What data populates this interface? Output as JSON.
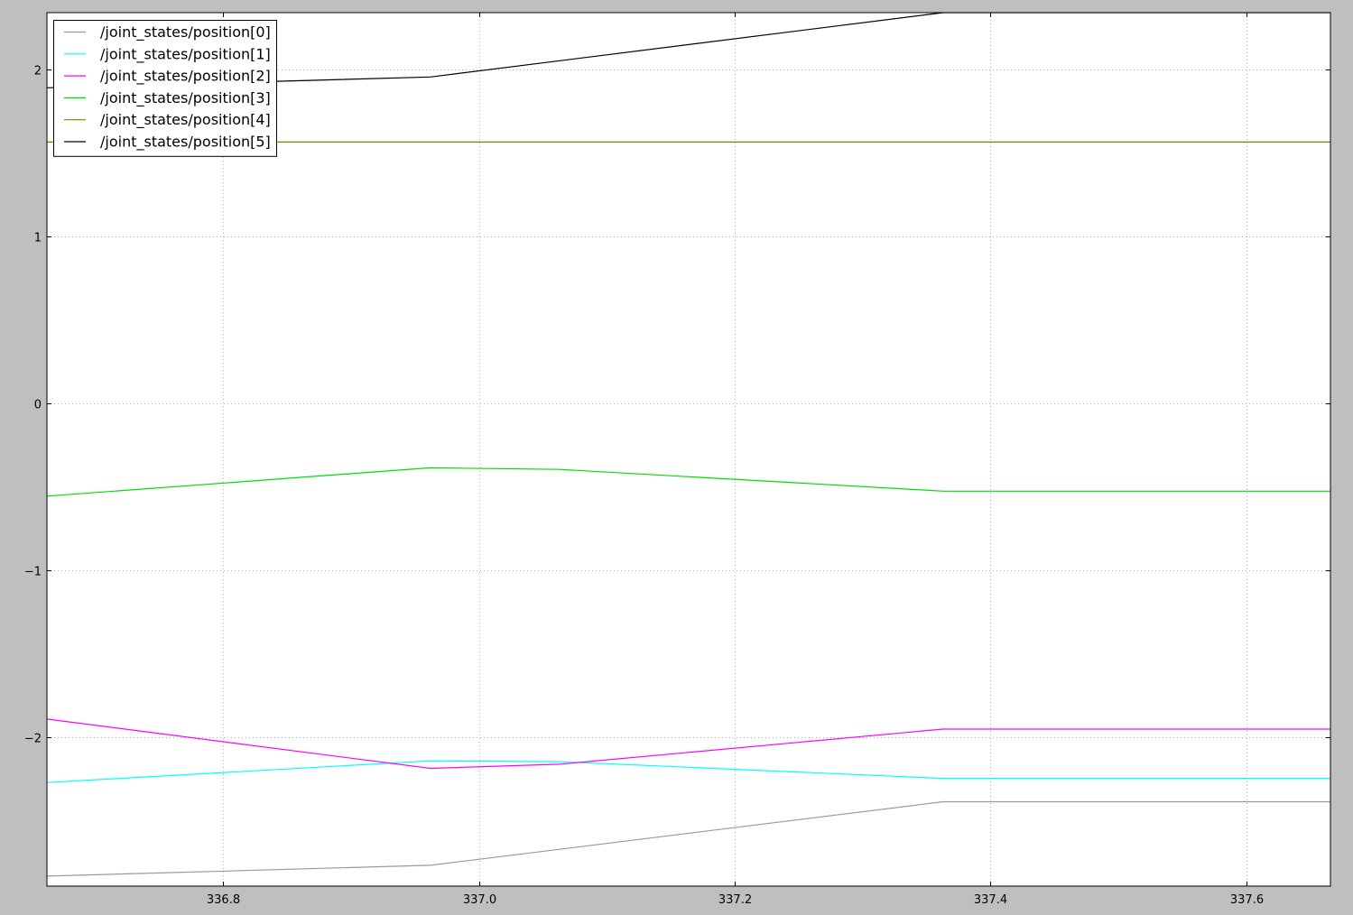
{
  "chart_data": {
    "type": "line",
    "title": "",
    "xlabel": "",
    "ylabel": "",
    "xlim": [
      336.662,
      337.666
    ],
    "ylim": [
      -2.89,
      2.34
    ],
    "xticks": [
      336.8,
      337.0,
      337.2,
      337.4,
      337.6
    ],
    "xtick_labels": [
      "336.8",
      "337.0",
      "337.2",
      "337.4",
      "337.6"
    ],
    "yticks": [
      2,
      1,
      0,
      -1,
      -2
    ],
    "ytick_labels": [
      "2",
      "1",
      "0",
      "−1",
      "−2"
    ],
    "grid": true,
    "legend_position": "top-left",
    "series": [
      {
        "name": "/joint_states/position[0]",
        "color": "#999999",
        "x": [
          336.662,
          336.962,
          337.363,
          337.666
        ],
        "y": [
          -2.83,
          -2.765,
          -2.385,
          -2.385
        ]
      },
      {
        "name": "/joint_states/position[1]",
        "color": "#00ffff",
        "x": [
          336.662,
          336.962,
          337.063,
          337.363,
          337.666
        ],
        "y": [
          -2.27,
          -2.14,
          -2.145,
          -2.245,
          -2.245
        ]
      },
      {
        "name": "/joint_states/position[2]",
        "color": "#ff00ff",
        "x": [
          336.662,
          336.962,
          337.063,
          337.363,
          337.666
        ],
        "y": [
          -1.89,
          -2.185,
          -2.16,
          -1.95,
          -1.95
        ]
      },
      {
        "name": "/joint_states/position[3]",
        "color": "#00dd00",
        "x": [
          336.662,
          336.962,
          337.063,
          337.363,
          337.666
        ],
        "y": [
          -0.555,
          -0.385,
          -0.395,
          -0.525,
          -0.525
        ]
      },
      {
        "name": "/joint_states/position[4]",
        "color": "#808000",
        "x": [
          336.662,
          337.666
        ],
        "y": [
          1.565,
          1.565
        ]
      },
      {
        "name": "/joint_states/position[5]",
        "color": "#000000",
        "x": [
          336.662,
          336.962,
          337.363,
          337.666
        ],
        "y": [
          1.89,
          1.955,
          2.34,
          2.34
        ]
      }
    ]
  }
}
